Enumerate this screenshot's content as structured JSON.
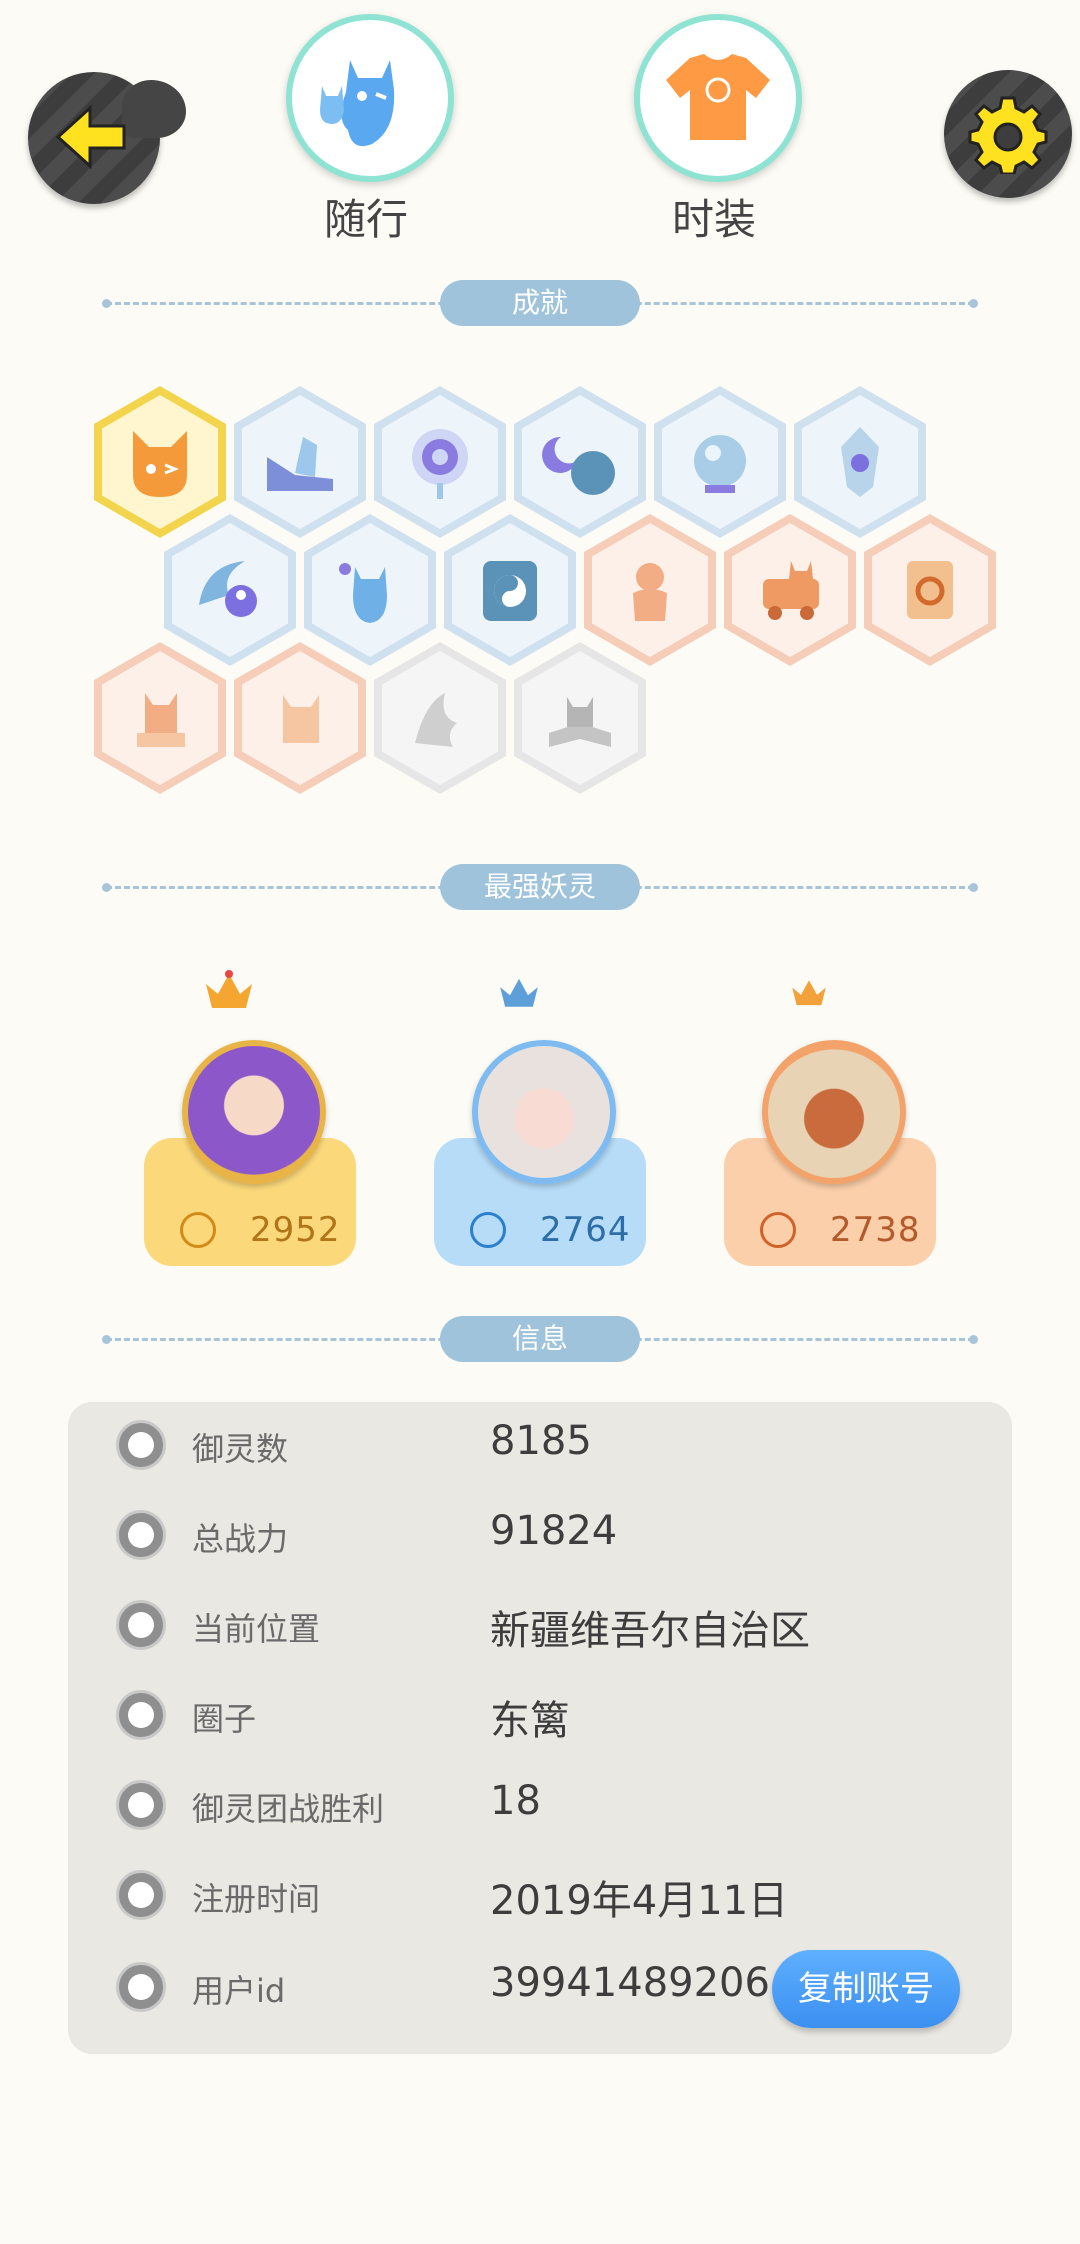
{
  "top_bar": {
    "back_icon": "arrow-left-icon",
    "settings_icon": "gear-icon",
    "follow_label": "随行",
    "fashion_label": "时装"
  },
  "sections": {
    "achievements": "成就",
    "strongest": "最强妖灵",
    "info": "信息"
  },
  "achievements": [
    {
      "icon": "fox-face-badge",
      "tier": "gold"
    },
    {
      "icon": "sneaker-badge",
      "tier": "blue"
    },
    {
      "icon": "portal-badge",
      "tier": "blue"
    },
    {
      "icon": "moon-planet-badge",
      "tier": "blue"
    },
    {
      "icon": "crystal-ball-badge",
      "tier": "blue"
    },
    {
      "icon": "crystal-badge",
      "tier": "blue"
    },
    {
      "icon": "yin-yang-swirl-badge",
      "tier": "blue"
    },
    {
      "icon": "cat-spirit-badge",
      "tier": "blue"
    },
    {
      "icon": "yin-yang-book-badge",
      "tier": "blue"
    },
    {
      "icon": "monkey-badge",
      "tier": "peach"
    },
    {
      "icon": "cat-cart-badge",
      "tier": "peach"
    },
    {
      "icon": "scroll-badge",
      "tier": "peach"
    },
    {
      "icon": "dragon-statue-badge",
      "tier": "peach"
    },
    {
      "icon": "fox-statue-badge",
      "tier": "peach"
    },
    {
      "icon": "dragon-wave-badge",
      "tier": "grey"
    },
    {
      "icon": "wolf-book-badge",
      "tier": "grey"
    }
  ],
  "monsters": [
    {
      "rank_icon": "gold-crown-icon",
      "power": "2952",
      "avatar": "pharaoh-girl-avatar"
    },
    {
      "rank_icon": "silver-crown-icon",
      "power": "2764",
      "avatar": "white-hair-girl-avatar"
    },
    {
      "rank_icon": "bronze-crown-icon",
      "power": "2738",
      "avatar": "fire-beast-avatar"
    }
  ],
  "info": [
    {
      "label": "御灵数",
      "value": "8185",
      "icon": "monster-count-icon"
    },
    {
      "label": "总战力",
      "value": "91824",
      "icon": "sword-icon"
    },
    {
      "label": "当前位置",
      "value": "新疆维吾尔自治区",
      "icon": "location-pin-icon"
    },
    {
      "label": "圈子",
      "value": "东篱",
      "icon": "circle-target-icon"
    },
    {
      "label": "御灵团战胜利",
      "value": "18",
      "icon": "trophy-icon"
    },
    {
      "label": "注册时间",
      "value": "2019年4月11日",
      "icon": "clock-icon"
    },
    {
      "label": "用户id",
      "value": "39941489206",
      "icon": "id-card-icon"
    }
  ],
  "copy_button": "复制账号",
  "colors": {
    "background": "#fcfbf5",
    "pill": "#9fc3da",
    "gold_card": "#fbd97b",
    "blue_card": "#b6dcf8",
    "orange_card": "#fbcfa9",
    "copy_button": "#4aa0f8"
  }
}
